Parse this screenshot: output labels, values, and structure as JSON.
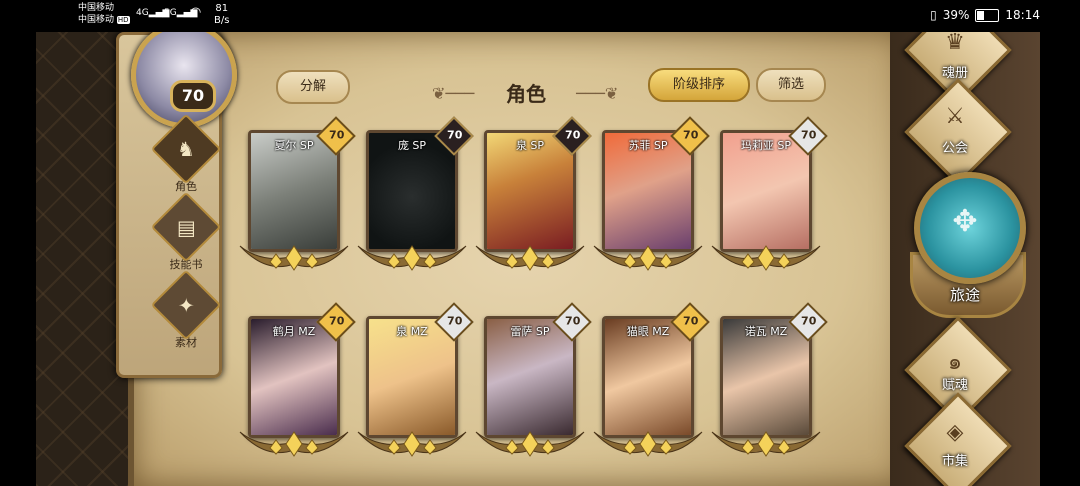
{
  "status_bar": {
    "carrier_line1": "中国移动",
    "carrier_line2": "中国移动",
    "hd_badge": "HD",
    "signal1": "4G",
    "signal2": "5G",
    "net_speed_value": "81",
    "net_speed_unit": "B/s",
    "battery_percent": "39%",
    "time": "18:14"
  },
  "player": {
    "level": "70"
  },
  "sidebar": {
    "items": [
      {
        "label": "角色",
        "icon": "character-icon",
        "active": true
      },
      {
        "label": "技能书",
        "icon": "skillbook-icon",
        "active": false
      },
      {
        "label": "素材",
        "icon": "material-icon",
        "active": false
      }
    ]
  },
  "header": {
    "title": "角色",
    "decompose_label": "分解",
    "sort_label": "阶级排序",
    "filter_label": "筛选"
  },
  "cards": [
    {
      "name": "夏尔 SP",
      "level": "70",
      "badge": "gold",
      "art": "silver-hair"
    },
    {
      "name": "庞 SP",
      "level": "70",
      "badge": "dark",
      "art": "black-panther"
    },
    {
      "name": "泉 SP",
      "level": "70",
      "badge": "dark",
      "art": "blonde-red"
    },
    {
      "name": "苏菲 SP",
      "level": "70",
      "badge": "gold",
      "art": "red-hair"
    },
    {
      "name": "玛莉亚 SP",
      "level": "70",
      "badge": "silver",
      "art": "pink-hair"
    },
    {
      "name": "鹤月 MZ",
      "level": "70",
      "badge": "gold",
      "art": "dark-hair"
    },
    {
      "name": "泉 MZ",
      "level": "70",
      "badge": "silver",
      "art": "blonde"
    },
    {
      "name": "雷萨 SP",
      "level": "70",
      "badge": "silver",
      "art": "vampire"
    },
    {
      "name": "猫眼 MZ",
      "level": "70",
      "badge": "gold",
      "art": "brown-hair"
    },
    {
      "name": "诺瓦 MZ",
      "level": "70",
      "badge": "silver",
      "art": "cap-girl"
    }
  ],
  "right_menu": {
    "soul_book": "魂册",
    "guild": "公会",
    "journey": "旅途",
    "talent": "赋魂",
    "market": "市集"
  },
  "colors": {
    "parchment": "#d8c394",
    "gold": "#f0c04a",
    "teal": "#2b93a0"
  }
}
